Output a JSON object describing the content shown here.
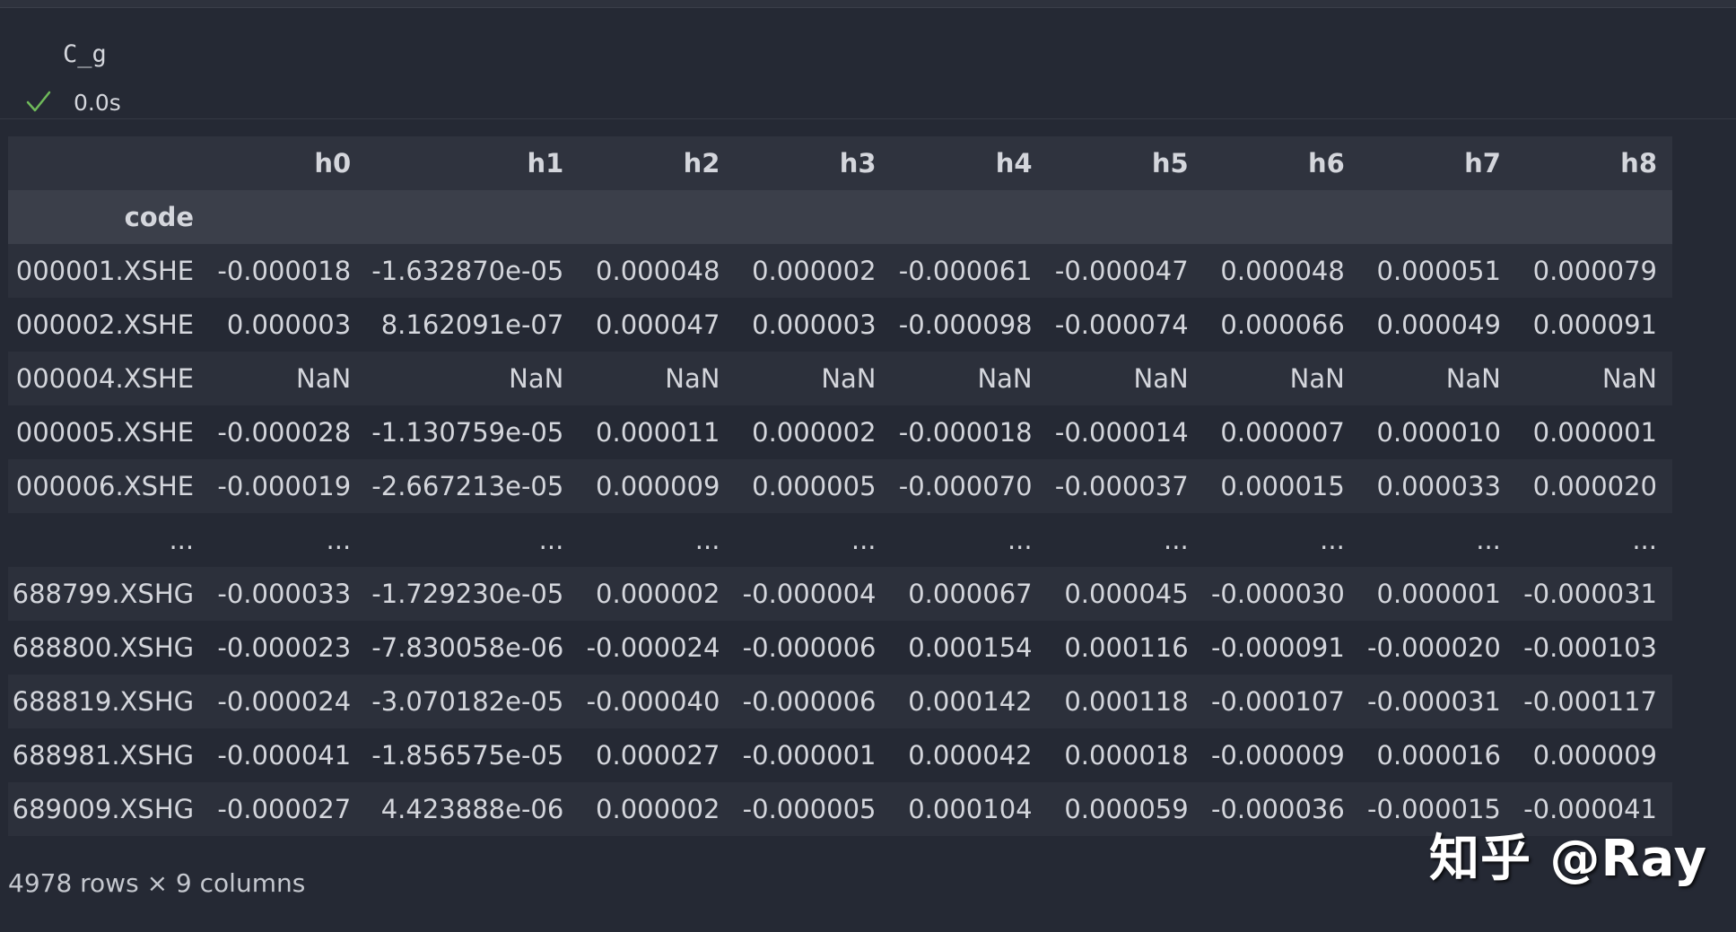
{
  "cell": {
    "code": "C_g",
    "exec_time": "0.0s",
    "status_color": "#6fba5a"
  },
  "dataframe": {
    "columns": [
      "h0",
      "h1",
      "h2",
      "h3",
      "h4",
      "h5",
      "h6",
      "h7",
      "h8"
    ],
    "index_name": "code",
    "rows": [
      {
        "index": "000001.XSHE",
        "values": [
          "-0.000018",
          "-1.632870e-05",
          "0.000048",
          "0.000002",
          "-0.000061",
          "-0.000047",
          "0.000048",
          "0.000051",
          "0.000079"
        ]
      },
      {
        "index": "000002.XSHE",
        "values": [
          "0.000003",
          "8.162091e-07",
          "0.000047",
          "0.000003",
          "-0.000098",
          "-0.000074",
          "0.000066",
          "0.000049",
          "0.000091"
        ]
      },
      {
        "index": "000004.XSHE",
        "values": [
          "NaN",
          "NaN",
          "NaN",
          "NaN",
          "NaN",
          "NaN",
          "NaN",
          "NaN",
          "NaN"
        ]
      },
      {
        "index": "000005.XSHE",
        "values": [
          "-0.000028",
          "-1.130759e-05",
          "0.000011",
          "0.000002",
          "-0.000018",
          "-0.000014",
          "0.000007",
          "0.000010",
          "0.000001"
        ]
      },
      {
        "index": "000006.XSHE",
        "values": [
          "-0.000019",
          "-2.667213e-05",
          "0.000009",
          "0.000005",
          "-0.000070",
          "-0.000037",
          "0.000015",
          "0.000033",
          "0.000020"
        ]
      },
      {
        "index": "...",
        "values": [
          "...",
          "...",
          "...",
          "...",
          "...",
          "...",
          "...",
          "...",
          "..."
        ]
      },
      {
        "index": "688799.XSHG",
        "values": [
          "-0.000033",
          "-1.729230e-05",
          "0.000002",
          "-0.000004",
          "0.000067",
          "0.000045",
          "-0.000030",
          "0.000001",
          "-0.000031"
        ]
      },
      {
        "index": "688800.XSHG",
        "values": [
          "-0.000023",
          "-7.830058e-06",
          "-0.000024",
          "-0.000006",
          "0.000154",
          "0.000116",
          "-0.000091",
          "-0.000020",
          "-0.000103"
        ]
      },
      {
        "index": "688819.XSHG",
        "values": [
          "-0.000024",
          "-3.070182e-05",
          "-0.000040",
          "-0.000006",
          "0.000142",
          "0.000118",
          "-0.000107",
          "-0.000031",
          "-0.000117"
        ]
      },
      {
        "index": "688981.XSHG",
        "values": [
          "-0.000041",
          "-1.856575e-05",
          "0.000027",
          "-0.000001",
          "0.000042",
          "0.000018",
          "-0.000009",
          "0.000016",
          "0.000009"
        ]
      },
      {
        "index": "689009.XSHG",
        "values": [
          "-0.000027",
          "4.423888e-06",
          "0.000002",
          "-0.000005",
          "0.000104",
          "0.000059",
          "-0.000036",
          "-0.000015",
          "-0.000041"
        ]
      }
    ],
    "shape_text": "4978 rows × 9 columns"
  },
  "watermark": "知乎 @Ray"
}
